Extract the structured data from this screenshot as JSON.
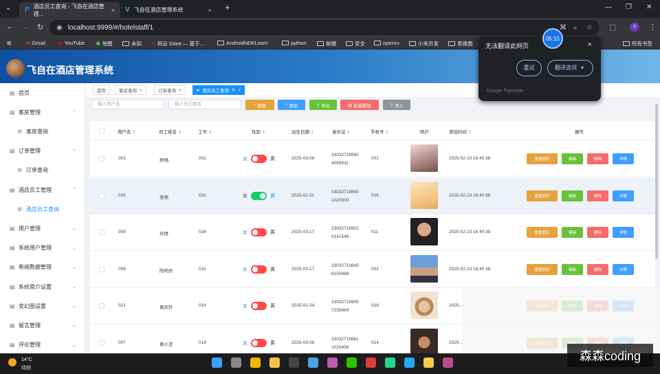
{
  "browser": {
    "tabs": [
      {
        "title": "酒店员工查询 - 飞自在酒店管理...",
        "active": true
      },
      {
        "title": "飞自在酒店管理系统",
        "active": false
      }
    ],
    "new_tab": "+",
    "url": "localhost:9999/#/hotelstaff/1",
    "window_controls": [
      "—",
      "❐",
      "✕"
    ],
    "bookmarks": [
      "Gmail",
      "YouTube",
      "地图",
      "未知",
      "码云 Gitee — 基于...",
      "AndroidNDKLearn",
      "python",
      "前端",
      "安全",
      "opencv",
      "小米开发",
      "思维图",
      "所有书签"
    ]
  },
  "app": {
    "title": "飞自在酒店管理系统"
  },
  "sidebar": {
    "items": [
      {
        "label": "首页",
        "icon": "home-icon",
        "arrow": ""
      },
      {
        "label": "客房管理",
        "icon": "bed-icon",
        "arrow": "⌃"
      },
      {
        "label": "客房查询",
        "icon": "settings-icon",
        "arrow": "",
        "sub": true
      },
      {
        "label": "订单管理",
        "icon": "order-icon",
        "arrow": "⌃"
      },
      {
        "label": "订单查询",
        "icon": "settings-icon",
        "arrow": "",
        "sub": true
      },
      {
        "label": "酒店员工管理",
        "icon": "staff-icon",
        "arrow": "⌃"
      },
      {
        "label": "酒店员工查询",
        "icon": "settings-icon",
        "arrow": "",
        "sub": true,
        "active": true
      },
      {
        "label": "用户管理",
        "icon": "user-icon",
        "arrow": "⌄"
      },
      {
        "label": "系统用户管理",
        "icon": "system-user-icon",
        "arrow": "⌄"
      },
      {
        "label": "新闻数据管理",
        "icon": "news-icon",
        "arrow": "⌄"
      },
      {
        "label": "系统简介设置",
        "icon": "intro-icon",
        "arrow": "⌄"
      },
      {
        "label": "变幻图设置",
        "icon": "carousel-icon",
        "arrow": "⌄"
      },
      {
        "label": "留言管理",
        "icon": "message-icon",
        "arrow": "⌄"
      },
      {
        "label": "评论管理",
        "icon": "comment-icon",
        "arrow": "⌄"
      }
    ]
  },
  "tags": [
    {
      "label": "首页"
    },
    {
      "label": "客房查询"
    },
    {
      "label": "订单查询"
    },
    {
      "label": "酒店员工查询",
      "active": true
    }
  ],
  "toolbar": {
    "username_placeholder": "输入用户名",
    "staffname_placeholder": "输入员工姓名",
    "search": "搜索",
    "add": "添加",
    "export": "导出",
    "batch_delete": "批量删除",
    "import": "导入"
  },
  "table": {
    "headers": [
      "用户名",
      "员工姓名",
      "工号",
      "性别",
      "出生日期",
      "身份证",
      "手机号",
      "照片",
      "添加时间",
      "操作"
    ],
    "gender_labels": {
      "female": "女",
      "male": "男"
    },
    "actions": [
      "重置密码",
      "编辑",
      "删除",
      "详情"
    ],
    "rows": [
      {
        "username": "001",
        "name": "舒畅",
        "staff_no": "001",
        "gender": "男",
        "birth": "2025-03-06",
        "id_card_1": "33032719950",
        "id_card_2": "4059511",
        "phone": "001",
        "added": "2025-02-23 16:40:38",
        "photo": "portrait-woman"
      },
      {
        "username": "005",
        "name": "张燕",
        "staff_no": "032",
        "gender": "女",
        "birth": "2025-02-21",
        "id_card_1": "33032719850",
        "id_card_2": "1020300",
        "phone": "016",
        "added": "2025-02-23 16:40:38",
        "photo": "anime-girl"
      },
      {
        "username": "009",
        "name": "孙倩",
        "staff_no": "034",
        "gender": "男",
        "birth": "2025-03-17",
        "id_card_1": "33032719901",
        "id_card_2": "0142546",
        "phone": "011",
        "added": "2025-02-23 16:40:38",
        "photo": "boy-face"
      },
      {
        "username": "006",
        "name": "陈明舟",
        "staff_no": "031",
        "gender": "男",
        "birth": "2025-03-17",
        "id_card_1": "33032719840",
        "id_card_2": "6150488",
        "phone": "002",
        "added": "2025-02-23 16:40:38",
        "photo": "boy-id-photo"
      },
      {
        "username": "021",
        "name": "黄庆轩",
        "staff_no": "014",
        "gender": "男",
        "birth": "2025-02-24",
        "id_card_1": "33032719900",
        "id_card_2": "723568X",
        "phone": "018",
        "added": "2025-...",
        "photo": "girl-hat"
      },
      {
        "username": "007",
        "name": "黄小芝",
        "staff_no": "019",
        "gender": "男",
        "birth": "2025-03-08",
        "id_card_1": "33032719881",
        "id_card_2": "1020456",
        "phone": "014",
        "added": "2025-...",
        "photo": "man-face"
      }
    ]
  },
  "translate": {
    "title": "无法翻译此网页",
    "retry": "重试",
    "options": "翻译选项",
    "brand": "Google Translate"
  },
  "clock": "05:15",
  "weather": {
    "temp": "14°C",
    "text": "晴朗"
  },
  "watermark": "森森coding",
  "colors": {
    "primary": "#1890ff",
    "reset": "#e6a23c",
    "edit": "#67c23a",
    "delete": "#f56c6c",
    "detail": "#409eff",
    "switch_on": "#13ce66",
    "switch_off": "#ff4949"
  }
}
